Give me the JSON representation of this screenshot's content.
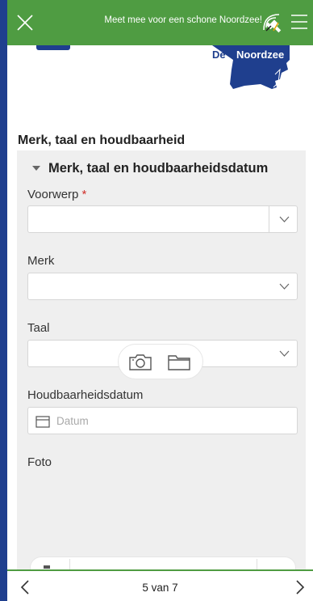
{
  "topbar": {
    "title": "Meet mee voor een schone Noordzee!",
    "close_icon": "close-icon",
    "satellite_icon": "satellite-icon",
    "menu_icon": "menu-icon",
    "color": "#4f9c42"
  },
  "header": {
    "logo_de": "De",
    "logo_noordzee": "Noordzee"
  },
  "section": {
    "title": "Merk, taal en houdbaarheid",
    "group_title": "Merk, taal en houdbaarheidsdatum"
  },
  "fields": {
    "voorwerp": {
      "label": "Voorwerp",
      "required_mark": "*",
      "value": ""
    },
    "merk": {
      "label": "Merk",
      "value": ""
    },
    "taal": {
      "label": "Taal",
      "value": ""
    },
    "houdbaarheid": {
      "label": "Houdbaarheidsdatum",
      "placeholder": "Datum"
    },
    "foto": {
      "label": "Foto"
    }
  },
  "footer": {
    "page_indicator": "5 van 7"
  },
  "colors": {
    "brand_green": "#4f9c42",
    "brand_blue": "#1f3f8e",
    "required": "#d0302a"
  }
}
